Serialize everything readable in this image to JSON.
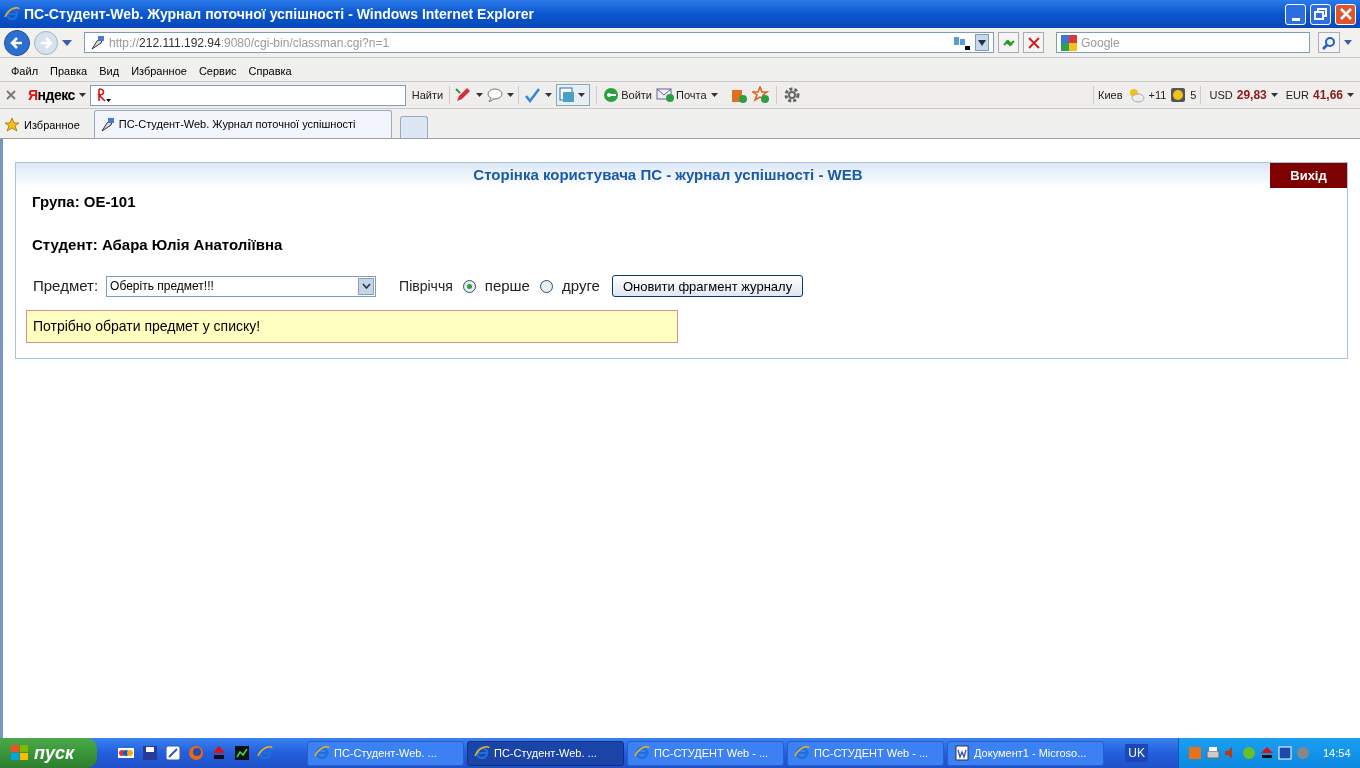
{
  "window": {
    "title": "ПС-Студент-Web. Журнал поточної успішності - Windows Internet Explorer"
  },
  "address": {
    "prefix": "http://",
    "host": "212.111.192.94",
    "rest": ":9080/cgi-bin/classman.cgi?n=1"
  },
  "search": {
    "placeholder": "Google"
  },
  "menu": [
    "Файл",
    "Правка",
    "Вид",
    "Избранное",
    "Сервис",
    "Справка"
  ],
  "yandex": {
    "logo": "Яндекс",
    "search_button": "Найти",
    "login": "Войти",
    "mail": "Почта",
    "city": "Киев",
    "temperature": "+11",
    "traffic": "5",
    "usd_label": "USD",
    "usd": "29,83",
    "eur_label": "EUR",
    "eur": "41,66"
  },
  "favorites": "Избранное",
  "tabs": [
    {
      "label": "ПС-Студент-Web. Журнал поточної успішності",
      "selected": true
    }
  ],
  "page": {
    "header": "Сторінка користувача ПС - журнал успішності - WEB",
    "logout": "Вихід",
    "group": "Група: ОЕ-101",
    "student": "Студент: Абара Юлія Анатоліївна",
    "subject_label": "Предмет:",
    "subject_value": "Оберіть предмет!!!",
    "semester_label": "Півріччя",
    "semesters": [
      {
        "label": "перше",
        "selected": true
      },
      {
        "label": "друге",
        "selected": false
      }
    ],
    "refresh_button": "Оновити фрагмент журналу",
    "message": "Потрібно обрати предмет у списку!"
  },
  "taskbar": {
    "start": "пуск",
    "tasks": [
      {
        "label": "ПС-Студент-Web. ...",
        "kind": "browser",
        "selected": false
      },
      {
        "label": "ПС-Студент-Web. ...",
        "kind": "browser",
        "selected": true
      },
      {
        "label": "ПС-СТУДЕНТ Web - ...",
        "kind": "browser",
        "selected": false
      },
      {
        "label": "ПС-СТУДЕНТ Web - ...",
        "kind": "browser",
        "selected": false
      },
      {
        "label": "Документ1 - Microso...",
        "kind": "document",
        "selected": false
      }
    ],
    "language": "UK",
    "clock": "14:54"
  }
}
